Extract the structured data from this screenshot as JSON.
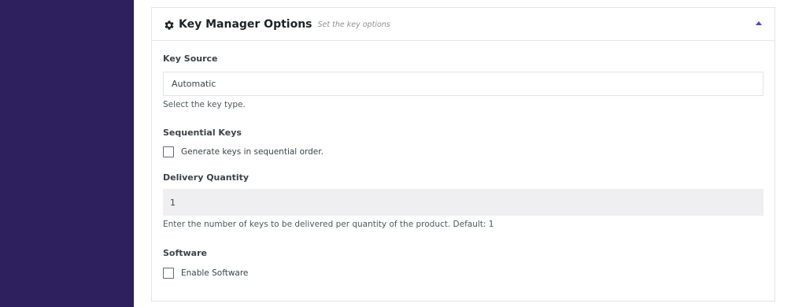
{
  "panel": {
    "title": "Key Manager Options",
    "subtitle": "Set the key options",
    "header_icon": "gear-icon",
    "collapse_icon": "triangle-up-icon",
    "accent_color": "#5b3fc4",
    "sidebar_color": "#2e1f5e"
  },
  "key_source": {
    "label": "Key Source",
    "value": "Automatic",
    "description": "Select the key type."
  },
  "sequential_keys": {
    "label": "Sequential Keys",
    "checkbox_label": "Generate keys in sequential order.",
    "checked": false
  },
  "delivery_quantity": {
    "label": "Delivery Quantity",
    "value": "1",
    "description": "Enter the number of keys to be delivered per quantity of the product. Default: 1"
  },
  "software": {
    "label": "Software",
    "checkbox_label": "Enable Software",
    "checked": false
  }
}
